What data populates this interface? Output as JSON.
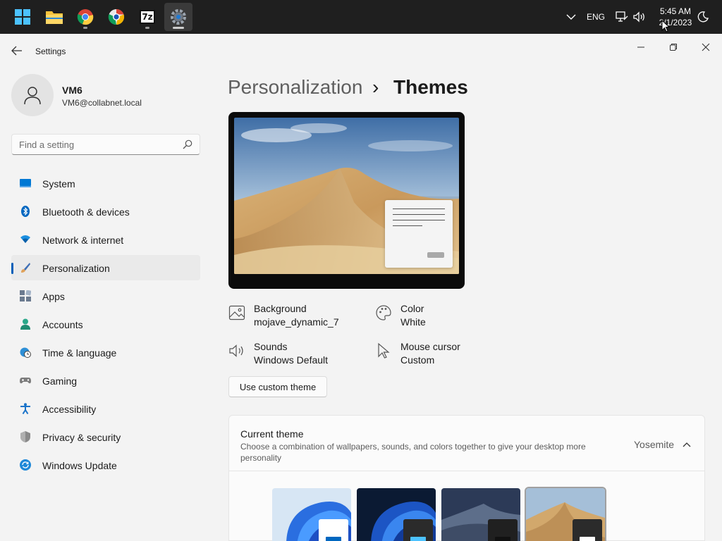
{
  "taskbar": {
    "apps": [
      {
        "name": "start-icon"
      },
      {
        "name": "file-explorer-icon"
      },
      {
        "name": "chrome-icon"
      },
      {
        "name": "chrome-alt-icon"
      },
      {
        "name": "7zip-icon",
        "label": "7z"
      },
      {
        "name": "settings-icon"
      }
    ],
    "tray": {
      "language": "ENG",
      "time": "5:45 AM",
      "date": "2/1/2023"
    }
  },
  "window": {
    "title": "Settings",
    "back_icon": "back-arrow-icon"
  },
  "profile": {
    "name": "VM6",
    "email": "VM6@collabnet.local"
  },
  "search": {
    "placeholder": "Find a setting"
  },
  "nav": {
    "items": [
      {
        "label": "System",
        "icon": "system-icon",
        "color": "#0078d4"
      },
      {
        "label": "Bluetooth & devices",
        "icon": "bluetooth-icon",
        "color": "#0067c0"
      },
      {
        "label": "Network & internet",
        "icon": "wifi-icon",
        "color": "#1b8fe0"
      },
      {
        "label": "Personalization",
        "icon": "brush-icon",
        "color": "#e0a25a"
      },
      {
        "label": "Apps",
        "icon": "apps-icon",
        "color": "#6b7a8f"
      },
      {
        "label": "Accounts",
        "icon": "accounts-icon",
        "color": "#2aa88a"
      },
      {
        "label": "Time & language",
        "icon": "globe-clock-icon",
        "color": "#2e8fd6"
      },
      {
        "label": "Gaming",
        "icon": "gamepad-icon",
        "color": "#7d7d7d"
      },
      {
        "label": "Accessibility",
        "icon": "accessibility-icon",
        "color": "#1a73c9"
      },
      {
        "label": "Privacy & security",
        "icon": "shield-icon",
        "color": "#8a8a8a"
      },
      {
        "label": "Windows Update",
        "icon": "update-icon",
        "color": "#1e88d8"
      }
    ],
    "selected_index": 3
  },
  "breadcrumb": {
    "parent": "Personalization",
    "separator": "›",
    "current": "Themes"
  },
  "properties": {
    "background": {
      "label": "Background",
      "value": "mojave_dynamic_7"
    },
    "color": {
      "label": "Color",
      "value": "White"
    },
    "sounds": {
      "label": "Sounds",
      "value": "Windows Default"
    },
    "cursor": {
      "label": "Mouse cursor",
      "value": "Custom"
    }
  },
  "custom_theme_button": "Use custom theme",
  "current_theme": {
    "title": "Current theme",
    "description": "Choose a combination of wallpapers, sounds, and colors together to give your desktop more personality",
    "value": "Yosemite"
  },
  "themes": [
    {
      "name": "theme-windows-light"
    },
    {
      "name": "theme-windows-dark"
    },
    {
      "name": "theme-mojave-night"
    },
    {
      "name": "theme-yosemite",
      "selected": true
    }
  ],
  "colors": {
    "accent": "#005fb8"
  }
}
